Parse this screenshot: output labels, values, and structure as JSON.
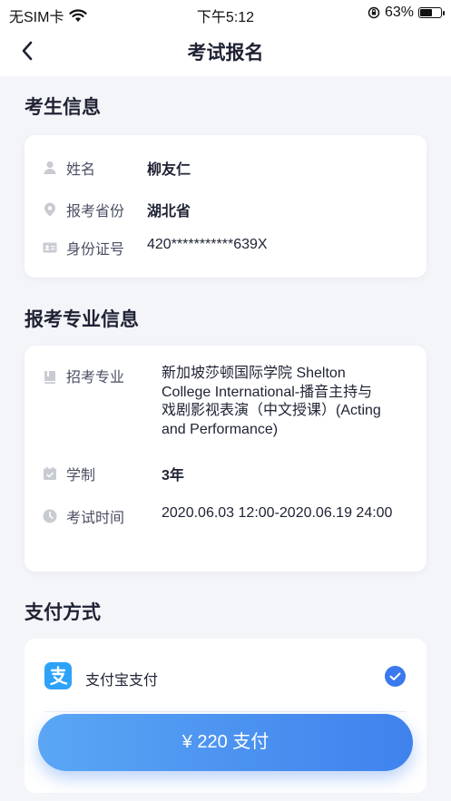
{
  "status_bar": {
    "carrier": "无SIM卡",
    "time": "下午5:12",
    "battery_percent": "63%",
    "battery_level": 0.63,
    "wifi_icon": "wifi-icon",
    "orientation_icon": "orientation-lock-icon"
  },
  "nav": {
    "title": "考试报名",
    "back_icon": "chevron-left-icon"
  },
  "candidate_info": {
    "section_title": "考生信息",
    "rows": [
      {
        "label": "姓名",
        "value": "柳友仁",
        "icon": "person-icon"
      },
      {
        "label": "报考省份",
        "value": "湖北省",
        "icon": "location-pin-icon"
      },
      {
        "label": "身份证号",
        "value": "420***********639X",
        "icon": "id-card-icon"
      }
    ]
  },
  "major_info": {
    "section_title": "报考专业信息",
    "rows": [
      {
        "label": "招考专业",
        "value_lines": [
          "新加坡莎顿国际学院 Shelton",
          "College International-播音主持与",
          "戏剧影视表演（中文授课）(Acting",
          "and Performance)"
        ],
        "icon": "book-icon"
      },
      {
        "label": "学制",
        "value": "3年",
        "icon": "calendar-icon"
      },
      {
        "label": "考试时间",
        "value": "2020.06.03 12:00-2020.06.19 24:00",
        "icon": "clock-icon"
      }
    ]
  },
  "payment": {
    "section_title": "支付方式",
    "method_label": "支付宝支付",
    "method_icon": "alipay-icon",
    "selected": true,
    "button_label": "¥ 220  支付",
    "colors": {
      "accent": "#3f82ed",
      "alipay": "#2ea2f8"
    }
  }
}
